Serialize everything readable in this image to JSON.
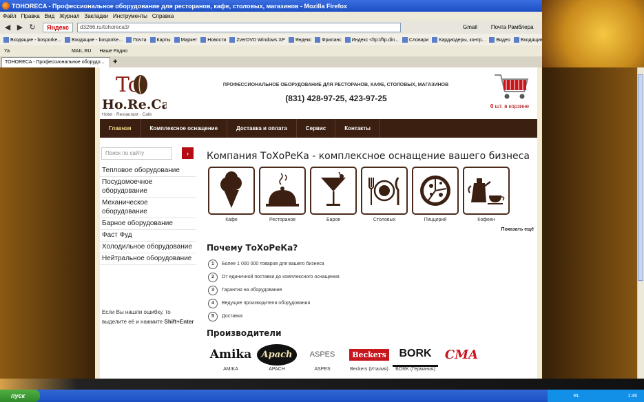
{
  "window": {
    "title": "TOHORECA - Профессиональное оборудование для ресторанов, кафе, столовых, магазинов - Mozilla Firefox",
    "controls": [
      "_",
      "□",
      "×"
    ]
  },
  "menubar": [
    "Файл",
    "Правка",
    "Вид",
    "Журнал",
    "Закладки",
    "Инструменты",
    "Справка"
  ],
  "navbar": {
    "back_icon": "back-arrow-icon",
    "forward_icon": "forward-arrow-icon",
    "search_engine": "Яндекс",
    "url": "d3266.ru/tohoreca3/",
    "right_items": [
      "Gmail",
      "Почта Рамблера"
    ]
  },
  "bookmarks": [
    "Входящие - bosporke...",
    "Входящие - bosporke...",
    "Почта",
    "Карты",
    "Маркет",
    "Новости",
    "ZverDVD Windows XP",
    "Яндекс",
    "Фриланс",
    "Индекс <ftp://ftp.din...",
    "Словари",
    "Кардиодеры, контр...",
    "Видео",
    "Входящие"
  ],
  "toolbar2": [
    "Ya",
    "MAIL.RU",
    "Наше Радио"
  ],
  "tab": {
    "label": "TOHORECA - Профессиональное оборудо..."
  },
  "site": {
    "logo": {
      "top": "To",
      "main": "Ho.Re.Ca",
      "sub": "Hotel · Restaurant · Cafe"
    },
    "tagline": "ПРОФЕССИОНАЛЬНОЕ ОБОРУДОВАНИЕ ДЛЯ РЕСТОРАНОВ, КАФЕ, СТОЛОВЫХ, МАГАЗИНОВ",
    "phone": "(831) 428-97-25, 423-97-25",
    "cart": {
      "count": "0",
      "label": "шт. в корзине"
    },
    "nav": [
      "Главная",
      "Комплексное оснащение",
      "Доставка и оплата",
      "Сервис",
      "Контакты"
    ],
    "search": {
      "placeholder": "Поиск по сайту",
      "button": "›"
    },
    "sidebar": [
      "Тепловое оборудование",
      "Посудомоечное оборудование",
      "Механическое оборудование",
      "Барное оборудование",
      "Фаст Фуд",
      "Холодильное оборудование",
      "Нейтральное оборудование"
    ],
    "note": {
      "text": "Если Вы нашли ошибку, то выделите её и нажмите",
      "keys": "Shift+Enter"
    },
    "heading": "Компания ТоХоРеКа - комплексное оснащение вашего бизнеса",
    "categories": [
      {
        "label": "Кафе",
        "icon": "ice-cream-icon"
      },
      {
        "label": "Ресторанов",
        "icon": "cloche-icon"
      },
      {
        "label": "Баров",
        "icon": "cocktail-icon"
      },
      {
        "label": "Столовых",
        "icon": "plate-cutlery-icon"
      },
      {
        "label": "Пиццерий",
        "icon": "pizza-icon"
      },
      {
        "label": "Кофеен",
        "icon": "coffee-pot-icon"
      }
    ],
    "show_more": "Показать ещё",
    "why_title": "Почему ТоХоРеКа?",
    "why": [
      {
        "n": "1",
        "text": "Более 1 000 000 товаров для вашего бизнеса"
      },
      {
        "n": "2",
        "text": "От единичной поставки до комплексного оснащения"
      },
      {
        "n": "3",
        "text": "Гарантия на оборудование"
      },
      {
        "n": "4",
        "text": "Ведущие производители оборудования"
      },
      {
        "n": "5",
        "text": "Доставка"
      }
    ],
    "brands_title": "Производители",
    "brands": [
      {
        "logo": "Amika",
        "name": "AMIKA"
      },
      {
        "logo": "Apach",
        "name": "APACH"
      },
      {
        "logo": "ASPES",
        "name": "ASPES"
      },
      {
        "logo": "Beckers",
        "name": "Beckers (Италия)"
      },
      {
        "logo": "BORK",
        "name": "BORK (Германия)"
      },
      {
        "logo": "CMA",
        "name": ""
      }
    ]
  },
  "taskbar": {
    "start": "пуск",
    "lang": "RL",
    "time": "1:46"
  },
  "colors": {
    "nav_bg": "#3b2012",
    "accent_red": "#b40e14",
    "icon_brown": "#4a2a1a"
  }
}
